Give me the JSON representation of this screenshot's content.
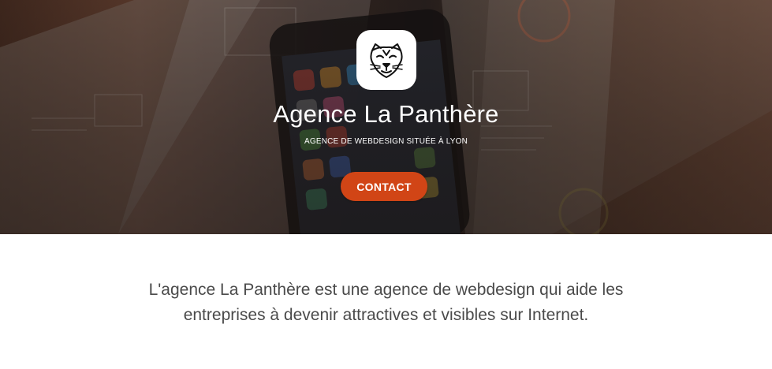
{
  "hero": {
    "logo_icon": "panther-head-icon",
    "title": "Agence La Panthère",
    "subtitle": "AGENCE DE WEBDESIGN SITUÉE À LYON",
    "contact_label": "CONTACT",
    "accent_color": "#d14516"
  },
  "intro": {
    "line1": "L'agence La Panthère est une agence de webdesign qui aide les",
    "line2": "entreprises à devenir attractives et visibles sur Internet."
  }
}
